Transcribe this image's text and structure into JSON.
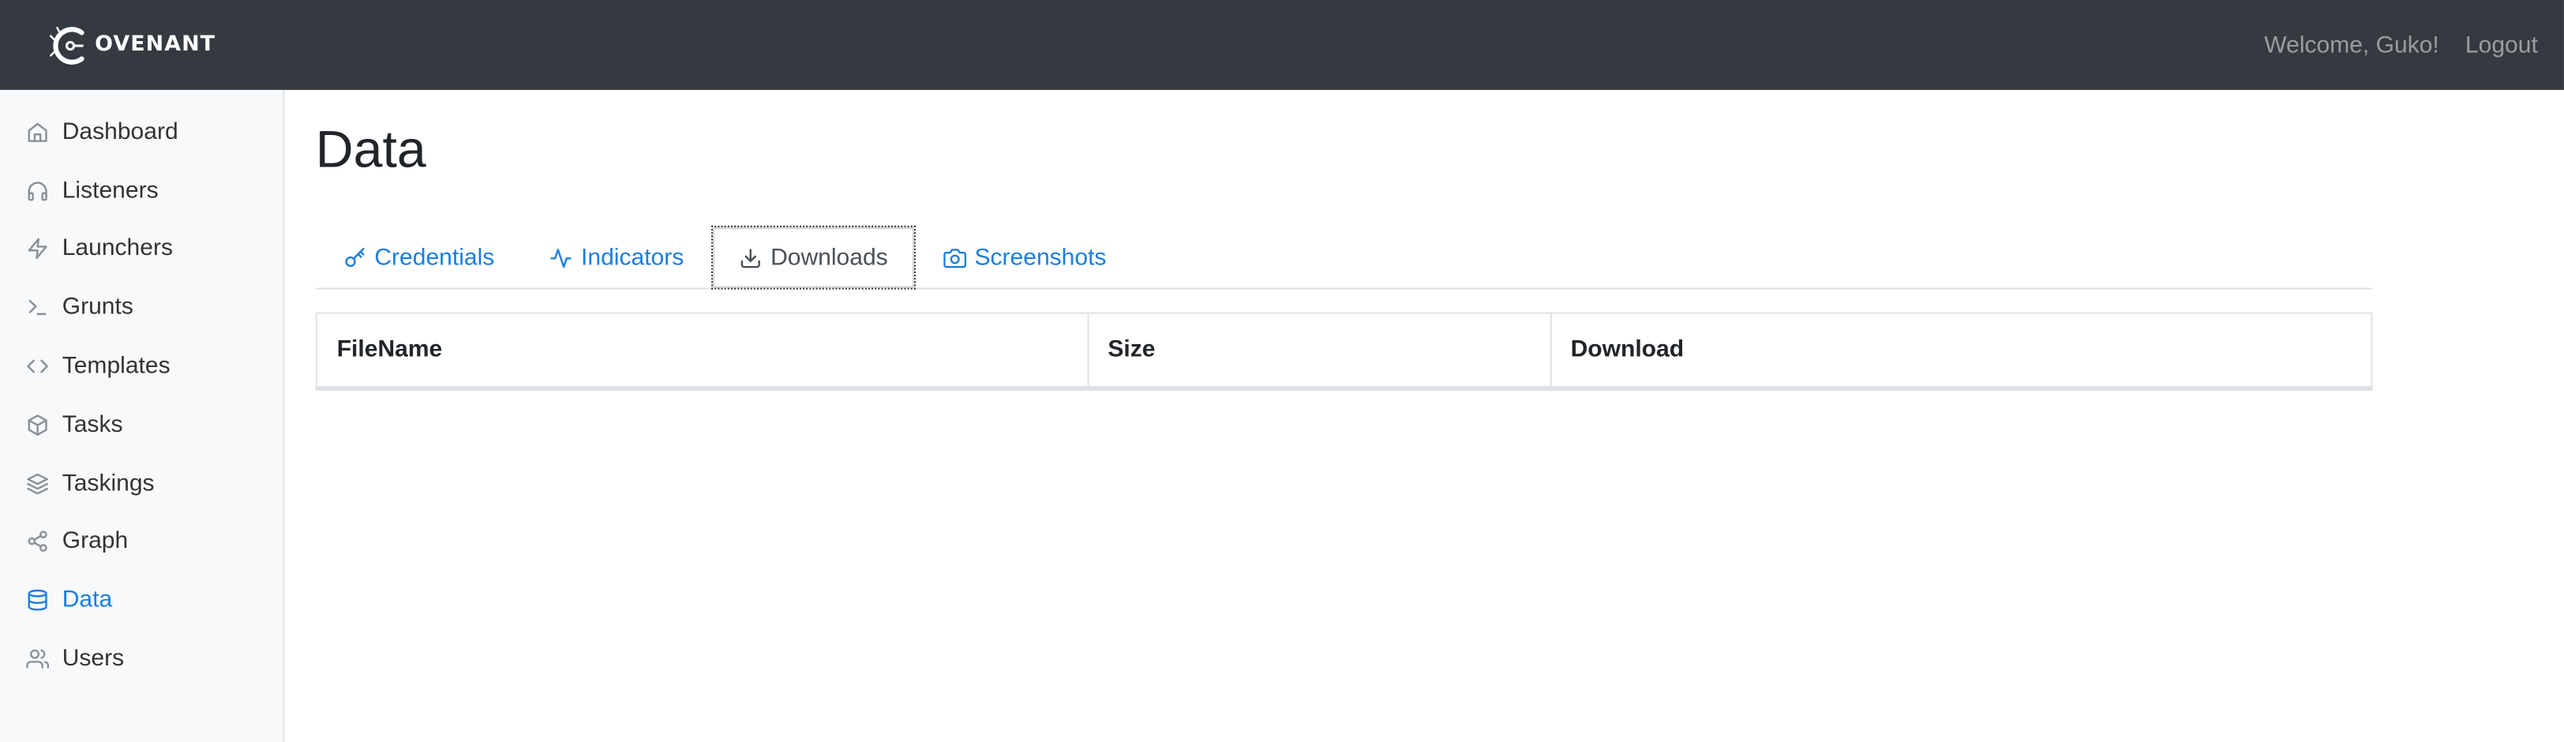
{
  "navbar": {
    "brand": "OVENANT",
    "welcome": "Welcome, Guko!",
    "logout": "Logout"
  },
  "sidebar": {
    "items": [
      {
        "label": "Dashboard",
        "icon": "home-icon"
      },
      {
        "label": "Listeners",
        "icon": "headphones-icon"
      },
      {
        "label": "Launchers",
        "icon": "zap-icon"
      },
      {
        "label": "Grunts",
        "icon": "terminal-icon"
      },
      {
        "label": "Templates",
        "icon": "code-icon"
      },
      {
        "label": "Tasks",
        "icon": "box-icon"
      },
      {
        "label": "Taskings",
        "icon": "layers-icon"
      },
      {
        "label": "Graph",
        "icon": "share-icon"
      },
      {
        "label": "Data",
        "icon": "database-icon",
        "active": true
      },
      {
        "label": "Users",
        "icon": "users-icon"
      }
    ]
  },
  "page": {
    "title": "Data"
  },
  "tabs": [
    {
      "label": "Credentials",
      "icon": "key-icon"
    },
    {
      "label": "Indicators",
      "icon": "activity-icon"
    },
    {
      "label": "Downloads",
      "icon": "download-icon",
      "active": true
    },
    {
      "label": "Screenshots",
      "icon": "camera-icon"
    }
  ],
  "table": {
    "columns": [
      "FileName",
      "Size",
      "Download"
    ]
  },
  "colors": {
    "navbar": "#343a40",
    "accent": "#1b7ee0",
    "sidebar": "#f8f9fa"
  }
}
